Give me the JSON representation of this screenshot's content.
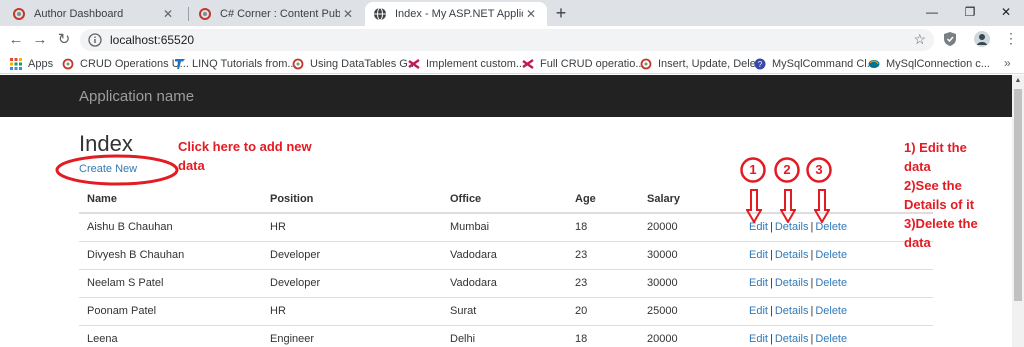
{
  "browser": {
    "tabs": [
      {
        "title": "Author Dashboard",
        "icon": "csharp-corner-icon",
        "active": false
      },
      {
        "title": "C# Corner : Content Publisher",
        "icon": "csharp-corner-icon",
        "active": false
      },
      {
        "title": "Index - My ASP.NET Application",
        "icon": "globe-icon",
        "active": true
      }
    ],
    "new_tab_label": "+",
    "url": "localhost:65520",
    "bookmarks": [
      {
        "label": "Apps",
        "icon": "apps-grid-icon"
      },
      {
        "label": "CRUD Operations U...",
        "icon": "csharp-corner-icon"
      },
      {
        "label": "LINQ Tutorials from...",
        "icon": "t-logo-icon"
      },
      {
        "label": "Using DataTables G...",
        "icon": "csharp-corner-icon"
      },
      {
        "label": "Implement custom...",
        "icon": "visual-studio-icon"
      },
      {
        "label": "Full CRUD operatio...",
        "icon": "visual-studio-icon"
      },
      {
        "label": "Insert, Update, Dele...",
        "icon": "csharp-corner-icon"
      },
      {
        "label": "MySqlCommand Cl...",
        "icon": "help-icon"
      },
      {
        "label": "MySqlConnection c...",
        "icon": "mysql-icon"
      }
    ]
  },
  "page": {
    "brand": "Application name",
    "title": "Index",
    "create_link": "Create New",
    "columns": [
      "Name",
      "Position",
      "Office",
      "Age",
      "Salary"
    ],
    "rows": [
      {
        "name": "Aishu B Chauhan",
        "position": "HR",
        "office": "Mumbai",
        "age": "18",
        "salary": "20000"
      },
      {
        "name": "Divyesh B Chauhan",
        "position": "Developer",
        "office": "Vadodara",
        "age": "23",
        "salary": "30000"
      },
      {
        "name": "Neelam S Patel",
        "position": "Developer",
        "office": "Vadodara",
        "age": "23",
        "salary": "30000"
      },
      {
        "name": "Poonam Patel",
        "position": "HR",
        "office": "Surat",
        "age": "20",
        "salary": "25000"
      },
      {
        "name": "Leena",
        "position": "Engineer",
        "office": "Delhi",
        "age": "18",
        "salary": "20000"
      }
    ],
    "actions": {
      "edit": "Edit",
      "details": "Details",
      "delete": "Delete",
      "separator": "|"
    }
  },
  "annotations": {
    "color": "#e31b23",
    "create_note": [
      "Click here to add new",
      "data"
    ],
    "numbers": [
      "1",
      "2",
      "3"
    ],
    "legend": [
      "1) Edit the",
      "data",
      "2)See the",
      "Details of it",
      "3)Delete the",
      "data"
    ]
  }
}
